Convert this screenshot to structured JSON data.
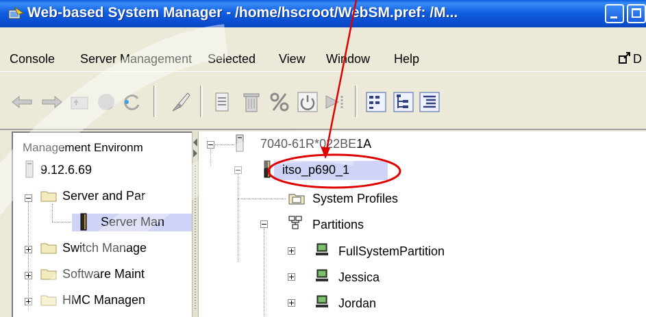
{
  "window": {
    "title": "Web-based System Manager - /home/hscroot/WebSM.pref: /M...",
    "buttons": [
      "minimize",
      "maximize"
    ]
  },
  "menubar": {
    "items": [
      "Console",
      "Server Management",
      "Selected",
      "View",
      "Window",
      "Help"
    ],
    "detach_label": "D"
  },
  "toolbar": {
    "icons": [
      "back-icon",
      "forward-icon",
      "up-folder-icon",
      "stop-icon",
      "refresh-icon",
      "brush-icon",
      "properties-icon",
      "delete-icon",
      "percent-icon",
      "power-icon",
      "activate-icon",
      "large-icons-view-icon",
      "tree-view-icon",
      "details-view-icon"
    ]
  },
  "left_tree": {
    "header": "Management Environm",
    "host": "9.12.6.69",
    "server_and_partition": "Server and Par",
    "server_management": "Server Man",
    "switch_management": "Switch Manage",
    "software_maintenance": "Software Maint",
    "hmc_management": "HMC Managen"
  },
  "right_tree": {
    "managed_system": "7040-61R*022BE1A",
    "selected_server": "itso_p690_1",
    "system_profiles": "System Profiles",
    "partitions": "Partitions",
    "partition_items": [
      "FullSystemPartition",
      "Jessica",
      "Jordan"
    ]
  },
  "colors": {
    "titlebar": "#0a4fd0",
    "selection": "#cfd3f5",
    "annotation": "#e00000"
  }
}
